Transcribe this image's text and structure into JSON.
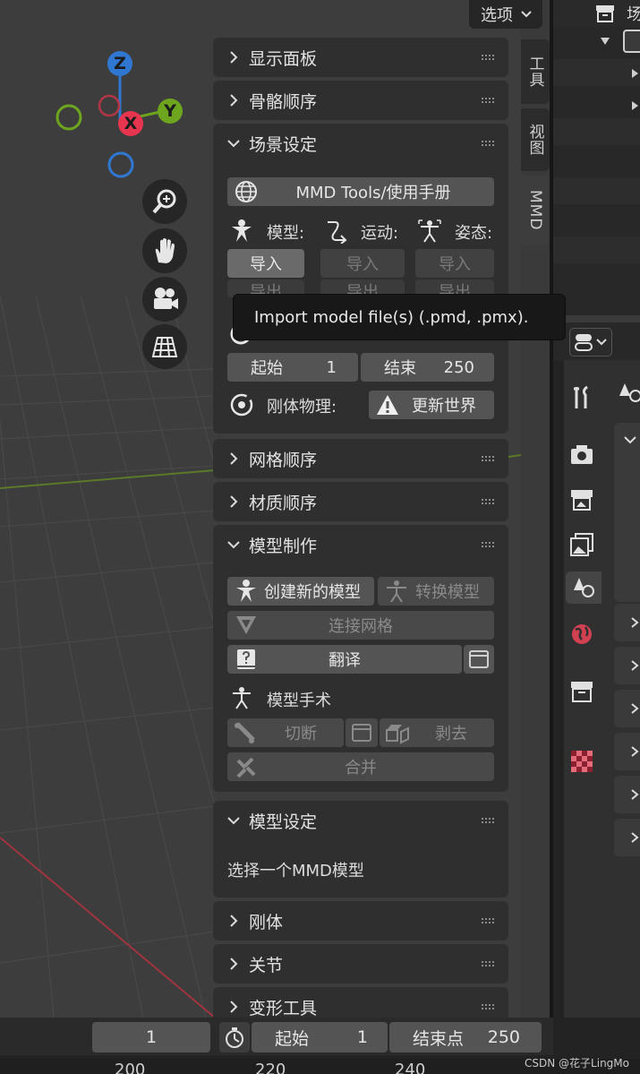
{
  "header": {
    "options_label": "选项"
  },
  "side_tabs": [
    "工具",
    "视图",
    "MMD"
  ],
  "panels": {
    "display_panel": "显示面板",
    "bone_order": "骨骼顺序",
    "scene_setup": "场景设定",
    "mesh_order": "网格顺序",
    "material_order": "材质顺序",
    "model_production": "模型制作",
    "model_setup": "模型设定",
    "rigid_body": "刚体",
    "joint": "关节",
    "morph_tools": "变形工具"
  },
  "scene_setup": {
    "manual_button": "MMD Tools/使用手册",
    "model_label": "模型:",
    "motion_label": "运动:",
    "pose_label": "姿态:",
    "import_label": "导入",
    "export_label": "导出",
    "start_label": "起始",
    "start_value": "1",
    "end_label": "结束",
    "end_value": "250",
    "rigid_physics_label": "刚体物理:",
    "update_world_button": "更新世界"
  },
  "model_production": {
    "create_model": "创建新的模型",
    "convert_model": "转换模型",
    "join_meshes": "连接网格",
    "translate": "翻译",
    "model_surgery": "模型手术",
    "cut": "切断",
    "peel": "剥去",
    "merge": "合并"
  },
  "model_setup": {
    "hint": "选择一个MMD模型"
  },
  "tooltip": "Import model file(s) (.pmd, .pmx).",
  "gizmo": {
    "z": "Z",
    "x": "X",
    "y": "Y"
  },
  "outliner": {
    "title_fragment": "场"
  },
  "timeline": {
    "current_frame": "1",
    "start_label": "起始",
    "start_value": "1",
    "end_label": "结束点",
    "end_value": "250",
    "ruler": [
      "200",
      "220",
      "240"
    ]
  },
  "watermark": "CSDN @花子LingMo",
  "colors": {
    "z_axis": "#2f77d1",
    "x_axis": "#e8354f",
    "y_axis": "#6ea51e",
    "accent": "#e8354f"
  }
}
